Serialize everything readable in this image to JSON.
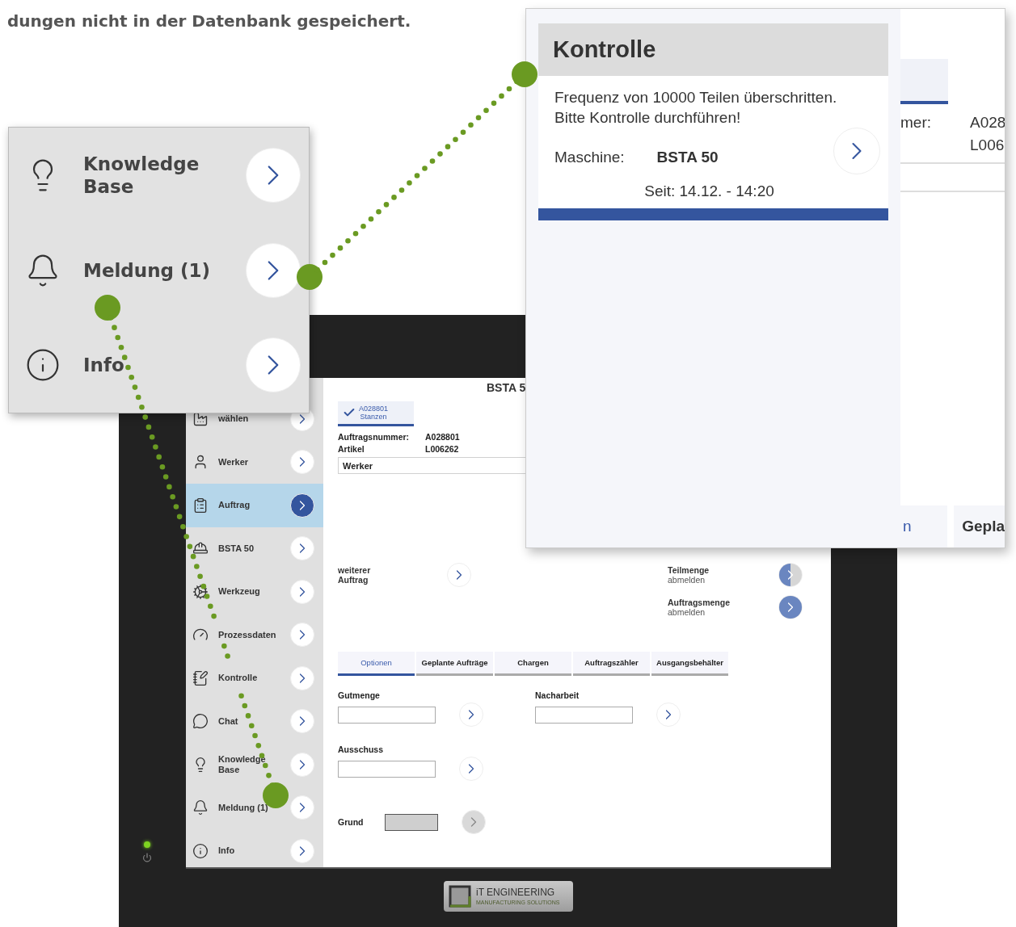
{
  "intro_text": "dungen nicht in der Datenbank gespeichert.",
  "callout": {
    "items": [
      {
        "label": "Knowledge Base"
      },
      {
        "label": "Meldung (1)"
      },
      {
        "label": "Info"
      }
    ]
  },
  "monitor": {
    "sidebar": {
      "items": [
        {
          "label": "wählen",
          "selected": false
        },
        {
          "label": "Werker",
          "selected": false
        },
        {
          "label": "Auftrag",
          "selected": true
        },
        {
          "label": "BSTA 50",
          "selected": false
        },
        {
          "label": "Werkzeug",
          "selected": false
        },
        {
          "label": "Prozessdaten",
          "selected": false
        },
        {
          "label": "Kontrolle",
          "selected": false
        },
        {
          "label": "Chat",
          "selected": false
        },
        {
          "label": "Knowledge Base",
          "selected": false
        },
        {
          "label": "Meldung (1)",
          "selected": false
        },
        {
          "label": "Info",
          "selected": false
        }
      ]
    },
    "title": "BSTA 5",
    "order_chip": {
      "lines": [
        "A028801",
        "Stanzen"
      ]
    },
    "order_info": [
      {
        "label": "Auftragsnummer:",
        "value": "A028801"
      },
      {
        "label": "Artikel",
        "value": "L006262"
      }
    ],
    "worker_field": {
      "value": "Werker"
    },
    "left_action": {
      "title": "weiterer Auftrag"
    },
    "right_actions": [
      {
        "title": "Teilmenge",
        "subtitle": "abmelden",
        "level": 0.5
      },
      {
        "title": "Auftragsmenge",
        "subtitle": "abmelden",
        "level": 1
      }
    ],
    "tabs": [
      {
        "label": "Optionen",
        "selected": true
      },
      {
        "label": "Geplante Aufträge",
        "selected": false
      },
      {
        "label": "Chargen",
        "selected": false
      },
      {
        "label": "Auftragszähler",
        "selected": false
      },
      {
        "label": "Ausgangsbehälter",
        "selected": false
      }
    ],
    "fields": [
      {
        "label": "Gutmenge",
        "kind": "stacked",
        "disabled": false
      },
      {
        "label": "Nacharbeit",
        "kind": "stacked",
        "disabled": false
      },
      {
        "label": "Ausschuss",
        "kind": "stacked",
        "disabled": false
      },
      {
        "label": "Grund",
        "kind": "inline",
        "disabled": true
      }
    ],
    "logo": {
      "name": "iT ENGINEERING",
      "tagline": "MANUFACTURING SOLUTIONS"
    }
  },
  "popup": {
    "title": "Kontrolle",
    "message_lines": [
      "Frequenz von 10000 Teilen überschritten.",
      "Bitte Kontrolle durchführen!"
    ],
    "machine_label": "Maschine:",
    "machine_value": "BSTA 50",
    "since": "Seit: 14.12. - 14:20",
    "background": {
      "label": "mer:",
      "values": [
        "A028",
        "L006"
      ],
      "tabs": [
        {
          "label": "n",
          "selected": true
        },
        {
          "label": "Gepla",
          "selected": false
        }
      ]
    }
  }
}
